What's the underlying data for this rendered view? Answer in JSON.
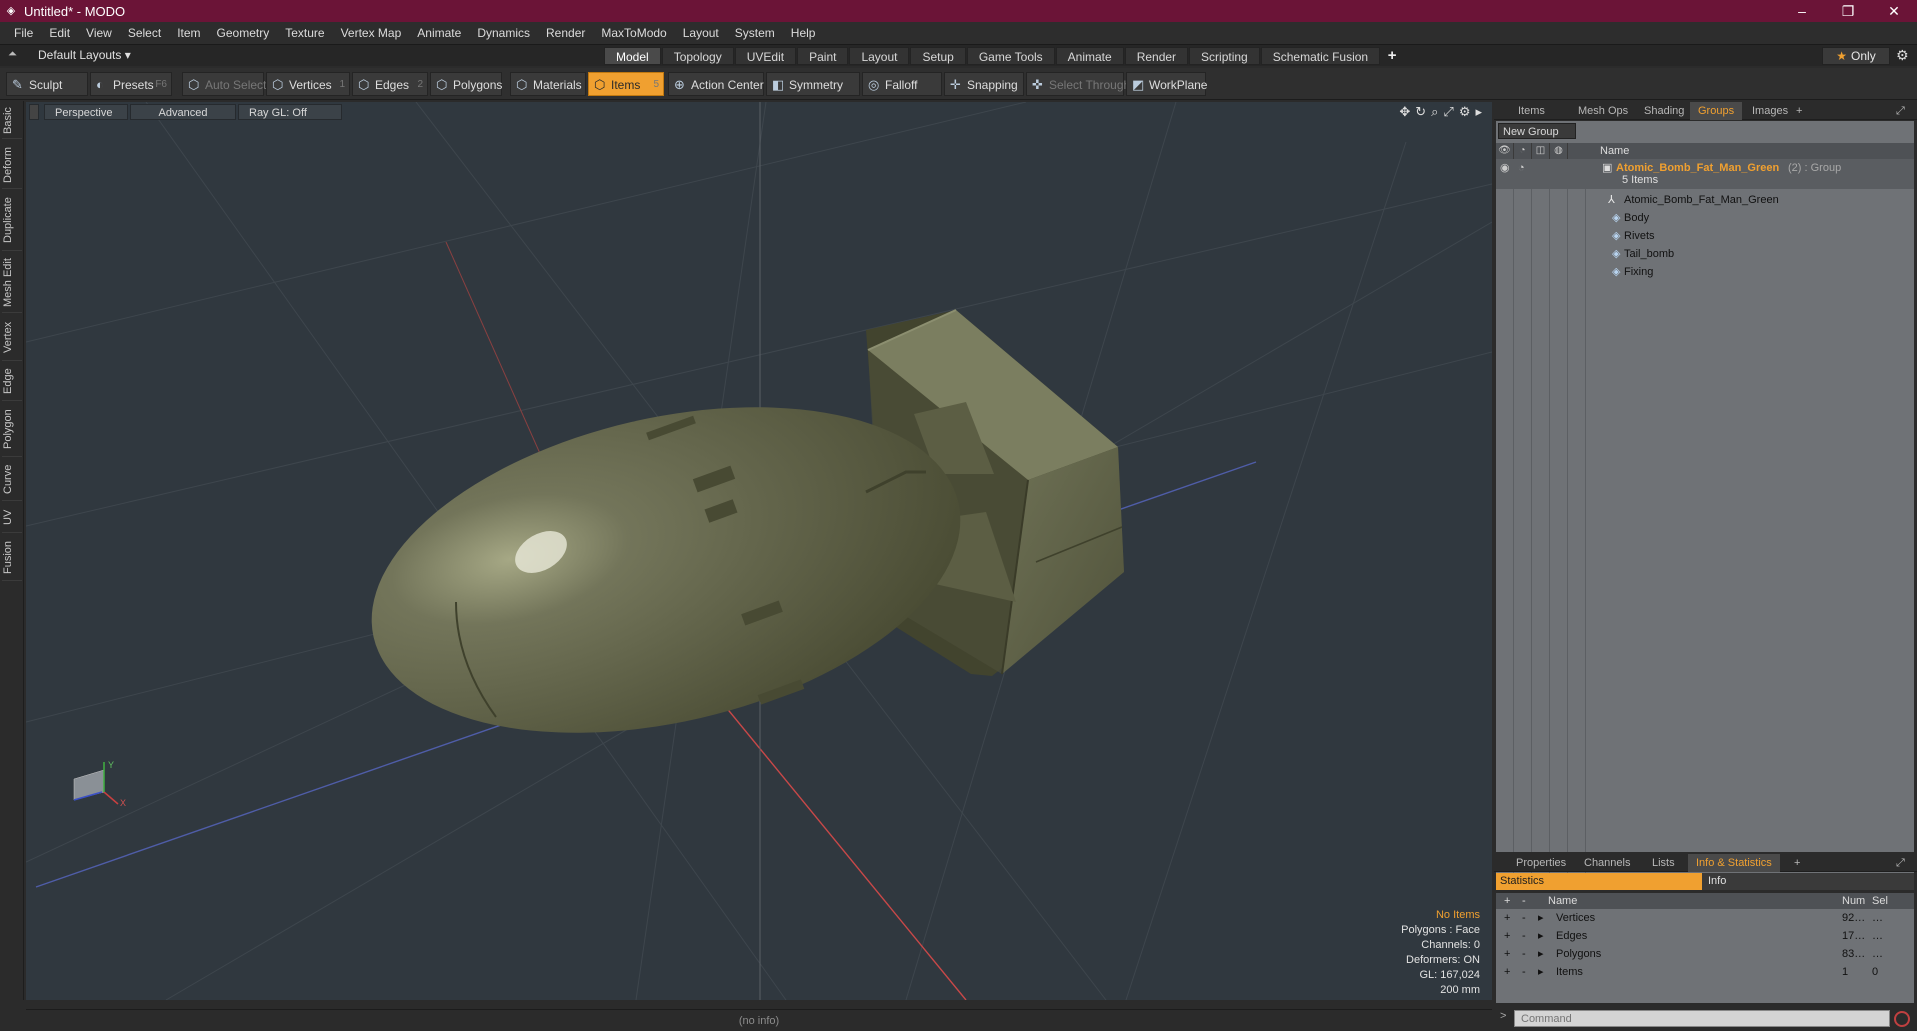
{
  "window": {
    "title": "Untitled* - MODO",
    "min": "–",
    "max": "❐",
    "close": "✕"
  },
  "menu": [
    "File",
    "Edit",
    "View",
    "Select",
    "Item",
    "Geometry",
    "Texture",
    "Vertex Map",
    "Animate",
    "Dynamics",
    "Render",
    "MaxToModo",
    "Layout",
    "System",
    "Help"
  ],
  "layoutbar": {
    "layouts": "Default Layouts ▾",
    "tabs": [
      "Model",
      "Topology",
      "UVEdit",
      "Paint",
      "Layout",
      "Setup",
      "Game Tools",
      "Animate",
      "Render",
      "Scripting",
      "Schematic Fusion"
    ],
    "active_tab": "Model",
    "plus": "+",
    "only": "Only"
  },
  "toolbar": {
    "sculpt": "Sculpt",
    "presets": "Presets",
    "presets_key": "F6",
    "auto_select": "Auto Select",
    "vertices": "Vertices",
    "vertices_key": "1",
    "edges": "Edges",
    "edges_key": "2",
    "polygons": "Polygons",
    "materials": "Materials",
    "items": "Items",
    "items_key": "5",
    "action_center": "Action Center",
    "symmetry": "Symmetry",
    "falloff": "Falloff",
    "snapping": "Snapping",
    "select_through": "Select Through",
    "workplane": "WorkPlane"
  },
  "lefttabs": [
    "Basic",
    "Deform",
    "Duplicate",
    "Mesh Edit",
    "Vertex",
    "Edge",
    "Polygon",
    "Curve",
    "UV",
    "Fusion"
  ],
  "viewport": {
    "view": "Perspective",
    "advanced": "Advanced",
    "raygl": "Ray GL: Off",
    "info": [
      "No Items",
      "Polygons : Face",
      "Channels: 0",
      "Deformers: ON",
      "GL: 167,024",
      "200 mm"
    ]
  },
  "status": "(no info)",
  "groups_panel": {
    "tabs": [
      "Items",
      "Mesh Ops",
      "Shading",
      "Groups",
      "Images"
    ],
    "active": "Groups",
    "new_group": "New Group",
    "name_col": "Name",
    "group_name": "Atomic_Bomb_Fat_Man_Green",
    "group_suffix": "(2) : Group",
    "count": "5 Items",
    "items": [
      "Atomic_Bomb_Fat_Man_Green",
      "Body",
      "Rivets",
      "Tail_bomb",
      "Fixing"
    ]
  },
  "bottom_panel": {
    "tabs": [
      "Properties",
      "Channels",
      "Lists",
      "Info & Statistics"
    ],
    "active": "Info & Statistics",
    "statistics": "Statistics",
    "info": "Info",
    "cols": {
      "name": "Name",
      "num": "Num",
      "sel": "Sel"
    },
    "rows": [
      {
        "name": "Vertices",
        "num": "92…",
        "sel": "…"
      },
      {
        "name": "Edges",
        "num": "17…",
        "sel": "…"
      },
      {
        "name": "Polygons",
        "num": "83…",
        "sel": "…"
      },
      {
        "name": "Items",
        "num": "1",
        "sel": "0"
      }
    ]
  },
  "command": {
    "placeholder": "Command"
  },
  "colors": {
    "accent": "#f0a030",
    "titlebar": "#6b1437",
    "viewport": "#30383f",
    "bomb": "#5f6244"
  }
}
